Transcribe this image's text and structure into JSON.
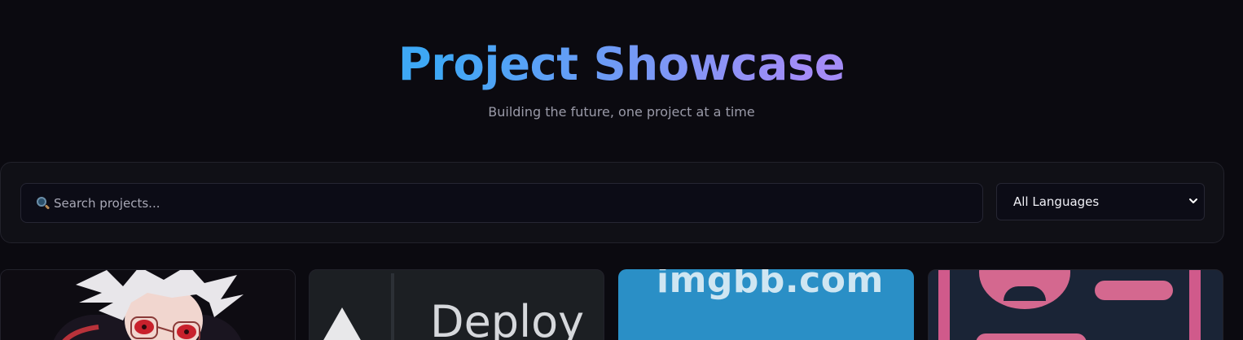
{
  "header": {
    "title": "Project Showcase",
    "subtitle": "Building the future, one project at a time"
  },
  "filters": {
    "search_placeholder": "Search projects...",
    "search_icon": "magnifying-glass-icon",
    "language_selected": "All Languages"
  },
  "cards": [
    {
      "thumbnail": "anime-character-avatar"
    },
    {
      "thumbnail": "vercel-deploy-banner",
      "text": "Deploy"
    },
    {
      "thumbnail": "imgbb-banner",
      "text": "imgbb.com"
    },
    {
      "thumbnail": "pink-ui-illustration"
    }
  ],
  "colors": {
    "background": "#0b0a10",
    "title_gradient_start": "#3ea8f5",
    "title_gradient_end": "#a48cf7",
    "panel": "#101016"
  }
}
